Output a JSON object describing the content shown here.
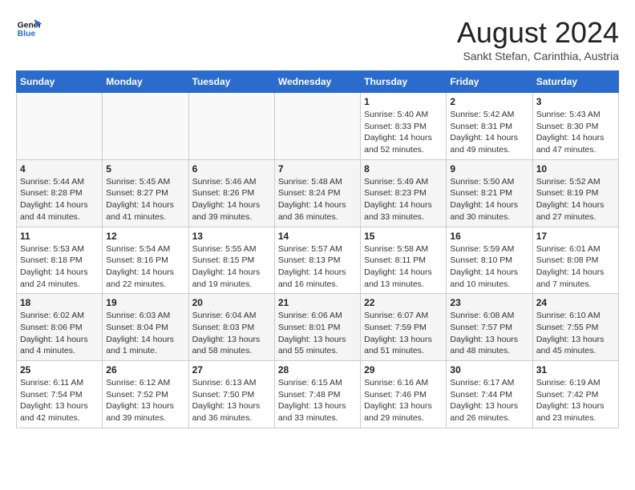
{
  "header": {
    "logo_line1": "General",
    "logo_line2": "Blue",
    "month_title": "August 2024",
    "subtitle": "Sankt Stefan, Carinthia, Austria"
  },
  "calendar": {
    "days_of_week": [
      "Sunday",
      "Monday",
      "Tuesday",
      "Wednesday",
      "Thursday",
      "Friday",
      "Saturday"
    ],
    "weeks": [
      [
        {
          "day": "",
          "info": ""
        },
        {
          "day": "",
          "info": ""
        },
        {
          "day": "",
          "info": ""
        },
        {
          "day": "",
          "info": ""
        },
        {
          "day": "1",
          "info": "Sunrise: 5:40 AM\nSunset: 8:33 PM\nDaylight: 14 hours\nand 52 minutes."
        },
        {
          "day": "2",
          "info": "Sunrise: 5:42 AM\nSunset: 8:31 PM\nDaylight: 14 hours\nand 49 minutes."
        },
        {
          "day": "3",
          "info": "Sunrise: 5:43 AM\nSunset: 8:30 PM\nDaylight: 14 hours\nand 47 minutes."
        }
      ],
      [
        {
          "day": "4",
          "info": "Sunrise: 5:44 AM\nSunset: 8:28 PM\nDaylight: 14 hours\nand 44 minutes."
        },
        {
          "day": "5",
          "info": "Sunrise: 5:45 AM\nSunset: 8:27 PM\nDaylight: 14 hours\nand 41 minutes."
        },
        {
          "day": "6",
          "info": "Sunrise: 5:46 AM\nSunset: 8:26 PM\nDaylight: 14 hours\nand 39 minutes."
        },
        {
          "day": "7",
          "info": "Sunrise: 5:48 AM\nSunset: 8:24 PM\nDaylight: 14 hours\nand 36 minutes."
        },
        {
          "day": "8",
          "info": "Sunrise: 5:49 AM\nSunset: 8:23 PM\nDaylight: 14 hours\nand 33 minutes."
        },
        {
          "day": "9",
          "info": "Sunrise: 5:50 AM\nSunset: 8:21 PM\nDaylight: 14 hours\nand 30 minutes."
        },
        {
          "day": "10",
          "info": "Sunrise: 5:52 AM\nSunset: 8:19 PM\nDaylight: 14 hours\nand 27 minutes."
        }
      ],
      [
        {
          "day": "11",
          "info": "Sunrise: 5:53 AM\nSunset: 8:18 PM\nDaylight: 14 hours\nand 24 minutes."
        },
        {
          "day": "12",
          "info": "Sunrise: 5:54 AM\nSunset: 8:16 PM\nDaylight: 14 hours\nand 22 minutes."
        },
        {
          "day": "13",
          "info": "Sunrise: 5:55 AM\nSunset: 8:15 PM\nDaylight: 14 hours\nand 19 minutes."
        },
        {
          "day": "14",
          "info": "Sunrise: 5:57 AM\nSunset: 8:13 PM\nDaylight: 14 hours\nand 16 minutes."
        },
        {
          "day": "15",
          "info": "Sunrise: 5:58 AM\nSunset: 8:11 PM\nDaylight: 14 hours\nand 13 minutes."
        },
        {
          "day": "16",
          "info": "Sunrise: 5:59 AM\nSunset: 8:10 PM\nDaylight: 14 hours\nand 10 minutes."
        },
        {
          "day": "17",
          "info": "Sunrise: 6:01 AM\nSunset: 8:08 PM\nDaylight: 14 hours\nand 7 minutes."
        }
      ],
      [
        {
          "day": "18",
          "info": "Sunrise: 6:02 AM\nSunset: 8:06 PM\nDaylight: 14 hours\nand 4 minutes."
        },
        {
          "day": "19",
          "info": "Sunrise: 6:03 AM\nSunset: 8:04 PM\nDaylight: 14 hours\nand 1 minute."
        },
        {
          "day": "20",
          "info": "Sunrise: 6:04 AM\nSunset: 8:03 PM\nDaylight: 13 hours\nand 58 minutes."
        },
        {
          "day": "21",
          "info": "Sunrise: 6:06 AM\nSunset: 8:01 PM\nDaylight: 13 hours\nand 55 minutes."
        },
        {
          "day": "22",
          "info": "Sunrise: 6:07 AM\nSunset: 7:59 PM\nDaylight: 13 hours\nand 51 minutes."
        },
        {
          "day": "23",
          "info": "Sunrise: 6:08 AM\nSunset: 7:57 PM\nDaylight: 13 hours\nand 48 minutes."
        },
        {
          "day": "24",
          "info": "Sunrise: 6:10 AM\nSunset: 7:55 PM\nDaylight: 13 hours\nand 45 minutes."
        }
      ],
      [
        {
          "day": "25",
          "info": "Sunrise: 6:11 AM\nSunset: 7:54 PM\nDaylight: 13 hours\nand 42 minutes."
        },
        {
          "day": "26",
          "info": "Sunrise: 6:12 AM\nSunset: 7:52 PM\nDaylight: 13 hours\nand 39 minutes."
        },
        {
          "day": "27",
          "info": "Sunrise: 6:13 AM\nSunset: 7:50 PM\nDaylight: 13 hours\nand 36 minutes."
        },
        {
          "day": "28",
          "info": "Sunrise: 6:15 AM\nSunset: 7:48 PM\nDaylight: 13 hours\nand 33 minutes."
        },
        {
          "day": "29",
          "info": "Sunrise: 6:16 AM\nSunset: 7:46 PM\nDaylight: 13 hours\nand 29 minutes."
        },
        {
          "day": "30",
          "info": "Sunrise: 6:17 AM\nSunset: 7:44 PM\nDaylight: 13 hours\nand 26 minutes."
        },
        {
          "day": "31",
          "info": "Sunrise: 6:19 AM\nSunset: 7:42 PM\nDaylight: 13 hours\nand 23 minutes."
        }
      ]
    ]
  }
}
